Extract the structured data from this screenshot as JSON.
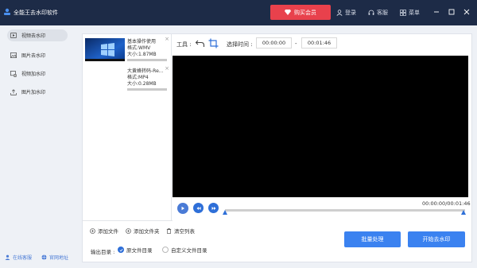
{
  "app": {
    "title": "全能王去水印软件"
  },
  "titlebar": {
    "buy_label": "购买会员",
    "login_label": "登录",
    "service_label": "客服",
    "menu_label": "菜单"
  },
  "nav": {
    "items": [
      {
        "label": "视频去水印",
        "icon": "video-icon"
      },
      {
        "label": "图片去水印",
        "icon": "image-icon"
      },
      {
        "label": "视频加水印",
        "icon": "video-add-icon"
      },
      {
        "label": "图片加水印",
        "icon": "image-upload-icon"
      }
    ],
    "footer_service": "在线客服",
    "footer_site": "官网地址"
  },
  "files": [
    {
      "name": "基本操作使用",
      "format": "格式:WMV",
      "size": "大小:1.87MB"
    },
    {
      "name": "大黄蜂转码-Re...",
      "format": "格式:MP4",
      "size": "大小:0.28MB"
    }
  ],
  "toolbar": {
    "tool_label": "工具 :",
    "time_label": "选择时间 :",
    "start_time": "00:00:00",
    "end_time": "00:01:46",
    "dash": "-"
  },
  "player": {
    "current": "00:00:00",
    "total": "00:01:46",
    "separator": "/"
  },
  "actions": {
    "add_file": "添加文件",
    "add_folder": "添加文件夹",
    "clear_list": "清空列表"
  },
  "output": {
    "label": "输出目录 :",
    "option_original": "原文件目录",
    "option_custom": "自定义文件目录"
  },
  "buttons": {
    "batch": "批量处理",
    "start": "开始去水印"
  },
  "colors": {
    "titlebar": "#1d2b47",
    "accent": "#3b82f0",
    "buy": "#e8414c"
  }
}
